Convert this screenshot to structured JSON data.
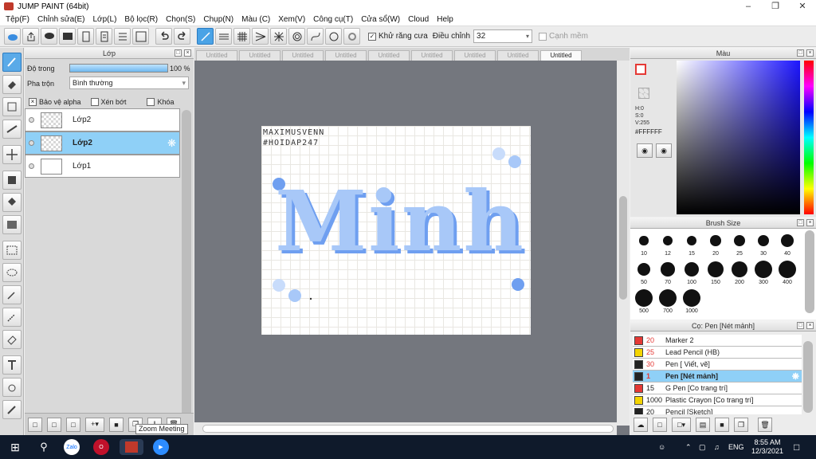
{
  "app": {
    "title": "JUMP PAINT (64bit)"
  },
  "menu": [
    "Tệp(F)",
    "Chỉnh sửa(E)",
    "Lớp(L)",
    "Bộ lọc(R)",
    "Chọn(S)",
    "Chụp(N)",
    "Màu (C)",
    "Xem(V)",
    "Công cụ(T)",
    "Cửa sổ(W)",
    "Cloud",
    "Help"
  ],
  "toolbar": {
    "antialias_label": "Khử răng cưa",
    "adjust_label": "Điều chỉnh",
    "adjust_value": "32",
    "snap_label": "Cạnh mềm"
  },
  "layer_panel": {
    "title": "Lớp",
    "opacity_label": "Độ trong",
    "opacity_value": "100 %",
    "blend_label": "Pha trộn",
    "blend_value": "Bình thường",
    "protect_alpha": "Bảo vệ alpha",
    "clip": "Xén bớt",
    "lock": "Khóa",
    "layers": [
      {
        "name": "Lớp2",
        "selected": false
      },
      {
        "name": "Lớp2",
        "selected": true
      },
      {
        "name": "Lớp1",
        "selected": false
      }
    ]
  },
  "tooltip": "Zoom Meeting",
  "canvas": {
    "tabs": [
      "Untitled",
      "Untitled",
      "Untitled",
      "Untitled",
      "Untitled",
      "Untitled",
      "Untitled",
      "Untitled",
      "Untitled"
    ],
    "active_tab": 8,
    "watermark_line1": "MAXIMUSVENN",
    "watermark_line2": "#HOIDAP247",
    "art_text": "Minh",
    "art_color": "#a8c8f8"
  },
  "color_panel": {
    "title": "Màu",
    "h": "H:0",
    "s": "S:0",
    "v": "V:255",
    "hex": "#FFFFFF"
  },
  "brush_panel": {
    "title": "Brush Size",
    "sizes": [
      "10",
      "12",
      "15",
      "20",
      "25",
      "30",
      "40",
      "50",
      "70",
      "100",
      "150",
      "200",
      "300",
      "400",
      "500",
      "700",
      "1000"
    ]
  },
  "pen_panel": {
    "title": "Cọ: Pen [Nét mảnh]",
    "items": [
      {
        "size": "20",
        "name": "Marker 2",
        "color": "#e53935",
        "size_color": "#e53935",
        "selected": false
      },
      {
        "size": "25",
        "name": "Lead Pencil (HB)",
        "color": "#f4d400",
        "size_color": "#e53935",
        "selected": false
      },
      {
        "size": "30",
        "name": "Pen [ Viết, vẽ]",
        "color": "#222222",
        "size_color": "#e53935",
        "selected": false
      },
      {
        "size": "1",
        "name": "Pen [Nét mảnh]",
        "color": "#222222",
        "size_color": "#e53935",
        "selected": true
      },
      {
        "size": "15",
        "name": "G Pen [Co trang trí]",
        "color": "#e53935",
        "size_color": "#222222",
        "selected": false
      },
      {
        "size": "1000",
        "name": "Plastic Crayon [Co trang trí]",
        "color": "#f4d400",
        "size_color": "#222222",
        "selected": false
      },
      {
        "size": "20",
        "name": "Pencil [Sketch]",
        "color": "#222222",
        "size_color": "#222222",
        "selected": false
      }
    ]
  },
  "taskbar": {
    "zalo": "Zalo",
    "lang": "ENG",
    "time": "8:55 AM",
    "date": "12/3/2021"
  }
}
